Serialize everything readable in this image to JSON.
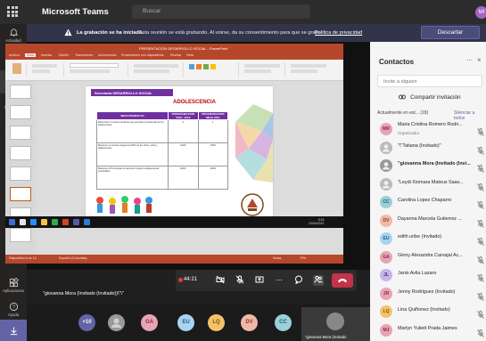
{
  "app": {
    "name": "Microsoft Teams",
    "search_placeholder": "Buscar",
    "user_initials": "MI"
  },
  "rail": [
    {
      "label": "Actividad",
      "icon": "bell-icon"
    },
    {
      "label": "Chat",
      "icon": "chat-icon"
    },
    {
      "label": "Equipos",
      "icon": "teams-icon",
      "active": true
    },
    {
      "label": "Calendario",
      "icon": "calendar-icon"
    },
    {
      "label": "Llamadas",
      "icon": "phone-icon"
    },
    {
      "label": "Archivos",
      "icon": "files-icon"
    },
    {
      "label": "...",
      "icon": "more-icon"
    },
    {
      "label": "Aplicaciones",
      "icon": "apps-icon"
    },
    {
      "label": "Ayuda",
      "icon": "help-icon"
    }
  ],
  "banner": {
    "title": "La grabación se ha iniciado.",
    "message": "Esta reunión se está grabando. Al unirse, da su consentimiento para que se grabe.",
    "link": "Política de privacidad",
    "dismiss": "Descartar"
  },
  "slide": {
    "header": "Secretaría DESARROLLO SOCIAL",
    "subtitle": "ADOLESCENCIA",
    "table_headers": [
      "META PRODUCTO",
      "PROGRAMACION 2016 - 2019",
      "PROGRAMACION META 2021"
    ],
    "rows": [
      {
        "text": "Estructurar 4 nuevos senderos que permitan el desarrollo de los adolescentes",
        "p1": "4",
        "p2": "1"
      },
      {
        "text": "Mantener el servicio integral al 100% de los niños, niñas y adolescentes",
        "p1": "100%",
        "p2": "100%"
      },
      {
        "text": "Mantener el Porcentaje de atención integral a adolescentes vulnerables",
        "p1": "100%",
        "p2": "100%"
      }
    ]
  },
  "meeting": {
    "presenter": "\"giovanna Mora (Invitado (Invitado))\\\"\\\"",
    "timer": "44:21",
    "self_name": "\"giovanna Mora (Invitado"
  },
  "gallery": [
    {
      "initials": "+10",
      "color": "#6264a7"
    },
    {
      "initials": "",
      "color": "#9a9a9a"
    },
    {
      "initials": "GA",
      "color": "#e8a4b4"
    },
    {
      "initials": "EU",
      "color": "#a8d4f0"
    },
    {
      "initials": "LQ",
      "color": "#f4c26a"
    },
    {
      "initials": "DV",
      "color": "#f0b8a8"
    },
    {
      "initials": "CC",
      "color": "#9ad0d8"
    }
  ],
  "contacts": {
    "title": "Contactos",
    "invite_placeholder": "Invite a alguien",
    "share_label": "Compartir invitación",
    "section_label": "Actualmente en est... (18)",
    "mute_all": "Silenciar a todos",
    "participants": [
      {
        "initials": "MR",
        "name": "Maria Cristina Romero Rodri...",
        "role": "Organizador",
        "color": "#e8a4b4",
        "fg": "#8a2a44"
      },
      {
        "initials": "",
        "name": "\"\\\"Tatiana (Invitado)\"",
        "color": "#bbbbbb",
        "fg": "#555"
      },
      {
        "initials": "",
        "name": "\"giovanna Mora (Invitado (Invi...",
        "color": "#999999",
        "fg": "#fff",
        "bold": true
      },
      {
        "initials": "",
        "name": "\"Leydi Xiomara Mateus Saav...",
        "color": "#bbbbbb",
        "fg": "#555"
      },
      {
        "initials": "CC",
        "name": "Carolina Lopez Chaparro",
        "color": "#9ad0d8",
        "fg": "#1b5d66"
      },
      {
        "initials": "DV",
        "name": "Dayanna Marcela Gutierrez ...",
        "color": "#f0b8a8",
        "fg": "#8a3a22"
      },
      {
        "initials": "EU",
        "name": "edith uribe (Invitado)",
        "color": "#a8d4f0",
        "fg": "#1c5a80"
      },
      {
        "initials": "GA",
        "name": "Ginny Alexandra Carvajal Ac...",
        "color": "#e8a4b4",
        "fg": "#8a2a44"
      },
      {
        "initials": "JL",
        "name": "Janis Avila Lazaro",
        "color": "#c8b4e8",
        "fg": "#4a2a80"
      },
      {
        "initials": "JR",
        "name": "Jenny Rodriguez (Invitado)",
        "color": "#e8a4b4",
        "fg": "#8a2a44"
      },
      {
        "initials": "LQ",
        "name": "Lina Quiñonez (Invitado)",
        "color": "#f4c26a",
        "fg": "#7a5200"
      },
      {
        "initials": "MJ",
        "name": "Marlyn Yuliett Prada Jaimes",
        "color": "#e8a4b4",
        "fg": "#8a2a44"
      }
    ]
  }
}
